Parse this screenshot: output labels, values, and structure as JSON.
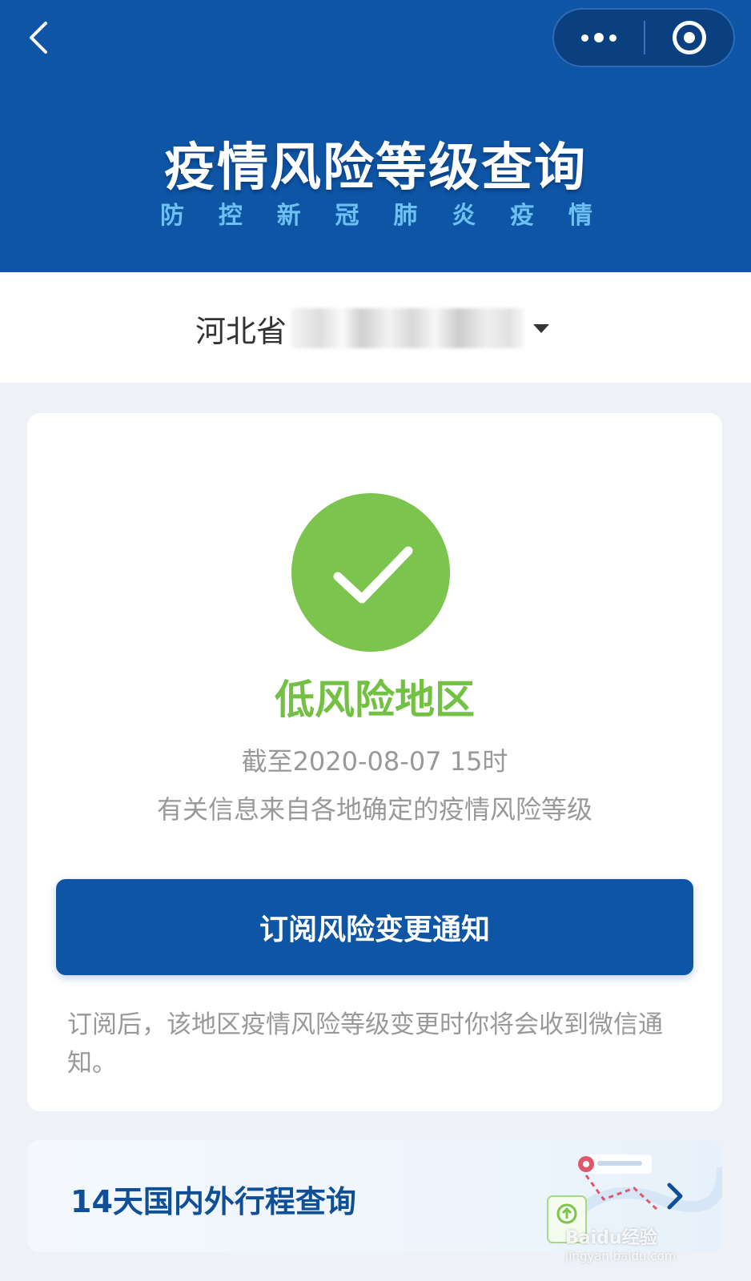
{
  "header": {
    "title": "疫情风险等级查询",
    "subtitle_chars": [
      "防",
      "控",
      "新",
      "冠",
      "肺",
      "炎",
      "疫",
      "情"
    ],
    "back_icon": "chevron-left-icon",
    "capsule": {
      "more_icon": "more-dots-icon",
      "close_icon": "target-circle-icon"
    }
  },
  "region": {
    "province": "河北省"
  },
  "result": {
    "status_icon": "check-icon",
    "status_color": "#7bc44d",
    "risk_level": "低风险地区",
    "as_of": "截至2020-08-07 15时",
    "source_note": "有关信息来自各地确定的疫情风险等级"
  },
  "subscribe": {
    "button_label": "订阅风险变更通知",
    "tip": "订阅后，该地区疫情风险等级变更时你将会收到微信通知。"
  },
  "trip_query": {
    "label": "14天国内外行程查询",
    "chevron_icon": "chevron-right-icon"
  },
  "watermark": {
    "brand": "Baidu经验",
    "url": "jingyan.baidu.com"
  },
  "colors": {
    "brand_blue": "#0e55a5",
    "success_green": "#72c143",
    "subtitle_blue": "#6ec0f2"
  }
}
